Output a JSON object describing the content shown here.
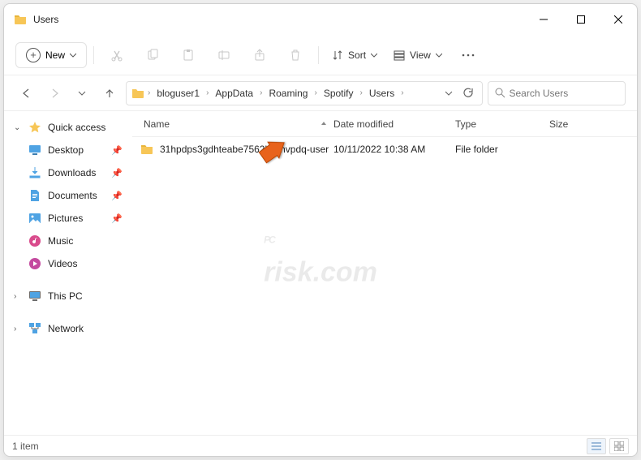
{
  "window": {
    "title": "Users"
  },
  "toolbar": {
    "new_label": "New",
    "sort_label": "Sort",
    "view_label": "View"
  },
  "breadcrumb": {
    "items": [
      "bloguser1",
      "AppData",
      "Roaming",
      "Spotify",
      "Users"
    ]
  },
  "search": {
    "placeholder": "Search Users"
  },
  "sidebar": {
    "quick_access": "Quick access",
    "desktop": "Desktop",
    "downloads": "Downloads",
    "documents": "Documents",
    "pictures": "Pictures",
    "music": "Music",
    "videos": "Videos",
    "this_pc": "This PC",
    "network": "Network"
  },
  "columns": {
    "name": "Name",
    "date": "Date modified",
    "type": "Type",
    "size": "Size"
  },
  "rows": [
    {
      "name": "31hpdps3gdhteabe7562kzohvpdq-user",
      "date": "10/11/2022 10:38 AM",
      "type": "File folder",
      "size": ""
    }
  ],
  "status": {
    "count": "1 item"
  },
  "watermark": {
    "line1": "PC",
    "line2": "risk.com"
  },
  "colors": {
    "folder": "#F7C657",
    "accent_blue": "#4FA3E3"
  }
}
